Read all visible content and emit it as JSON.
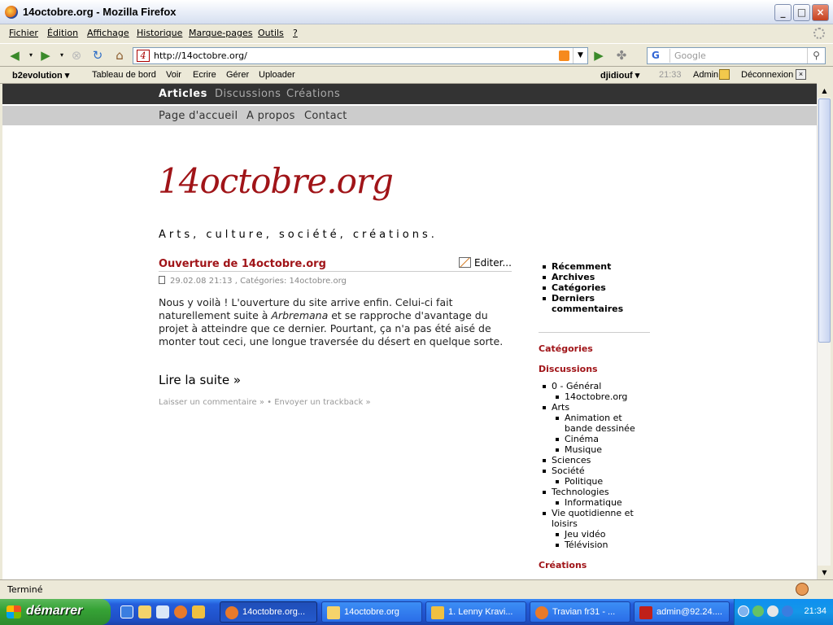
{
  "window": {
    "title": "14octobre.org - Mozilla Firefox",
    "min": "_",
    "max": "□",
    "close": "×"
  },
  "menu": [
    "Fichier",
    "Édition",
    "Affichage",
    "Historique",
    "Marque-pages",
    "Outils",
    "?"
  ],
  "navbar": {
    "url": "http://14octobre.org/",
    "search_placeholder": "Google",
    "search_engine": "G"
  },
  "b2bar": {
    "brand": "b2evolution ▾",
    "items": [
      "Tableau de bord",
      "Voir",
      "Ecrire",
      "Gérer",
      "Uploader"
    ],
    "user": "djidiouf ▾",
    "time": "21:33",
    "admin": "Admin",
    "logout": "Déconnexion"
  },
  "site": {
    "nav_primary": [
      "Articles",
      "Discussions",
      "Créations"
    ],
    "nav_secondary": [
      "Page d'accueil",
      "A propos",
      "Contact"
    ],
    "logo": "14octobre.org",
    "tagline": "Arts, culture, société, créations."
  },
  "post": {
    "title": "Ouverture de 14octobre.org",
    "edit": "Editer...",
    "meta": "29.02.08 21:13 , Catégories: 14octobre.org",
    "excerpt_1": "Nous y voilà ! L'ouverture du site arrive enfin. Celui-ci fait naturellement suite à ",
    "excerpt_em": "Arbremana",
    "excerpt_2": " et se rapproche d'avantage du projet à atteindre que ce dernier. Pourtant, ça n'a pas été aisé de monter tout ceci, une longue traversée du désert en quelque sorte.",
    "more": "Lire la suite »",
    "feedback": "Laisser un commentaire » • Envoyer un trackback »"
  },
  "sidebar": {
    "top": [
      "Récemment",
      "Archives",
      "Catégories",
      "Derniers commentaires"
    ],
    "h_categories": "Catégories",
    "h_discussions": "Discussions",
    "h_creations": "Créations",
    "cats": [
      {
        "label": "0 - Général",
        "level": 0
      },
      {
        "label": "14octobre.org",
        "level": 1
      },
      {
        "label": "Arts",
        "level": 0
      },
      {
        "label": "Animation et bande dessinée",
        "level": 1
      },
      {
        "label": "Cinéma",
        "level": 1
      },
      {
        "label": "Musique",
        "level": 1
      },
      {
        "label": "Sciences",
        "level": 0
      },
      {
        "label": "Société",
        "level": 0
      },
      {
        "label": "Politique",
        "level": 1
      },
      {
        "label": "Technologies",
        "level": 0
      },
      {
        "label": "Informatique",
        "level": 1
      },
      {
        "label": "Vie quotidienne et loisirs",
        "level": 0
      },
      {
        "label": "Jeu vidéo",
        "level": 1
      },
      {
        "label": "Télévision",
        "level": 1
      }
    ]
  },
  "status": "Terminé",
  "taskbar": {
    "start": "démarrer",
    "tasks": [
      "14octobre.org...",
      "14octobre.org",
      "1. Lenny Kravi...",
      "Travian fr31 - ...",
      "admin@92.24...."
    ],
    "clock": "21:34"
  }
}
